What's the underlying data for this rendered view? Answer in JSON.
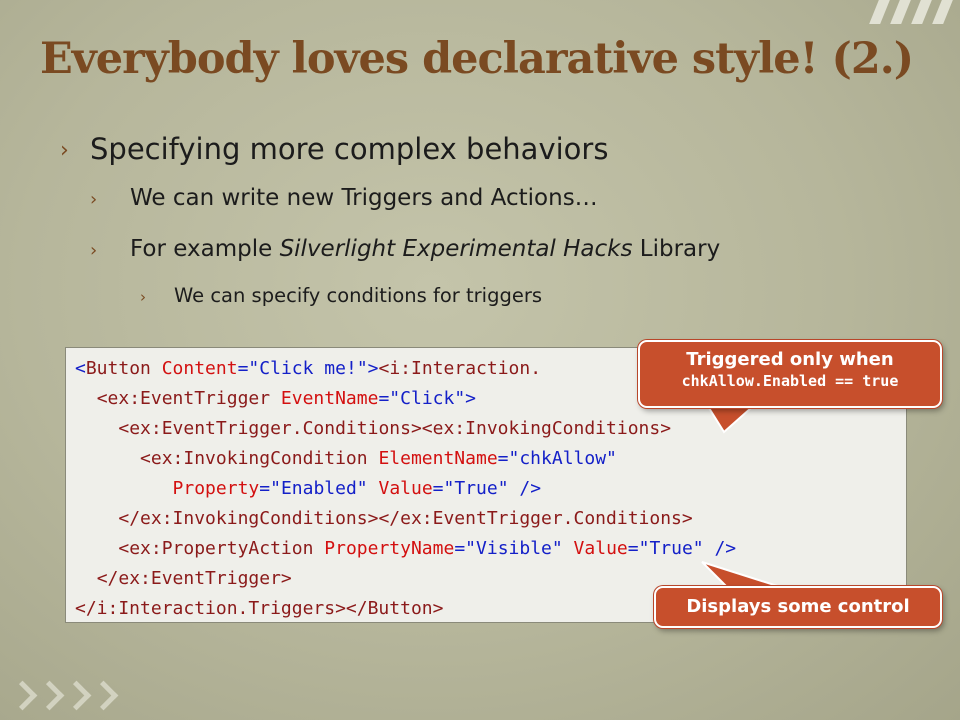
{
  "title": "Everybody loves declarative style!  (2.)",
  "bullet_marker": "›",
  "bullets": {
    "level1": "Specifying more complex behaviors",
    "level2a": "We can write new Triggers and Actions…",
    "level2b_before": "For example ",
    "level2b_italic": "Silverlight Experimental Hacks",
    "level2b_after": " Library",
    "level3": "We can specify conditions for triggers"
  },
  "code": {
    "line1_open": "<",
    "line1_tag": "Button",
    "line1_attr": " Content",
    "line1_eq": "=\"",
    "line1_val": "Click me!",
    "line1_close": "\">",
    "line1_tag2": "<i:Interaction.",
    "line2_indent": "  ",
    "line2_tag": "<ex:EventTrigger",
    "line2_attr": " EventName",
    "line2_eq": "=\"",
    "line2_val": "Click",
    "line2_close": "\">",
    "line3_indent": "    ",
    "line3_tag": "<ex:EventTrigger.Conditions><ex:InvokingConditions>",
    "line4_indent": "      ",
    "line4_tag": "<ex:InvokingCondition",
    "line4_attr": " ElementName",
    "line4_eq": "=\"",
    "line4_val": "chkAllow",
    "line4_close": "\"",
    "line5_indent": "         ",
    "line5_attr1": "Property",
    "line5_eq1": "=\"",
    "line5_val1": "Enabled",
    "line5_q1": "\"",
    "line5_attr2": " Value",
    "line5_eq2": "=\"",
    "line5_val2": "True",
    "line5_close": "\" />",
    "line6_indent": "    ",
    "line6_tag": "</ex:InvokingConditions></ex:EventTrigger.Conditions>",
    "line7_indent": "    ",
    "line7_tag": "<ex:PropertyAction",
    "line7_attr1": " PropertyName",
    "line7_eq1": "=\"",
    "line7_val1": "Visible",
    "line7_q1": "\"",
    "line7_attr2": " Value",
    "line7_eq2": "=\"",
    "line7_val2": "True",
    "line7_close": "\" />",
    "line8_indent": "  ",
    "line8_tag": "</ex:EventTrigger>",
    "line9_tag": "</i:Interaction.Triggers></Button>"
  },
  "callouts": {
    "top_line1": "Triggered only when",
    "top_line2": "chkAllow.Enabled == true",
    "bottom": "Displays some control"
  },
  "colors": {
    "title": "#7a4a22",
    "callout": "#c74f2c",
    "code_tag": "#8b1a1a",
    "code_attr": "#d31010",
    "code_value": "#1420c8"
  }
}
